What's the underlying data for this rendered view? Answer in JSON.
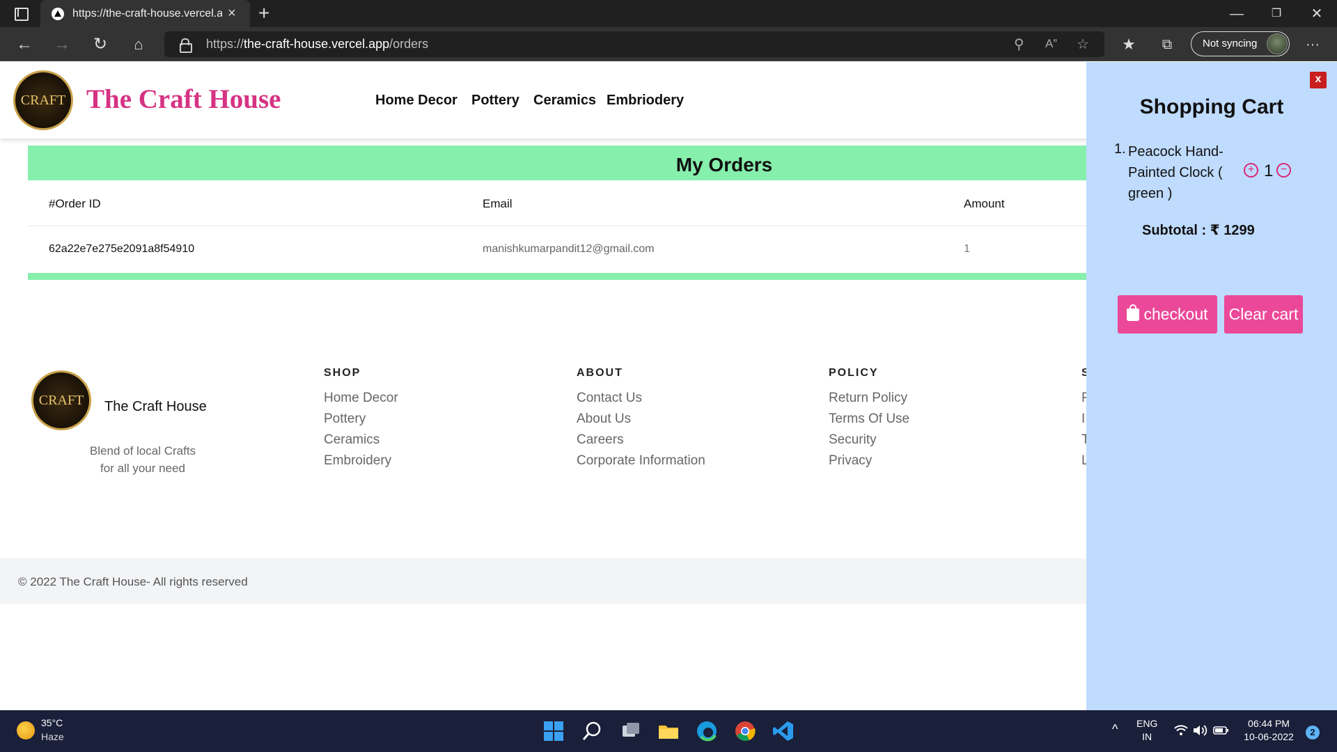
{
  "browser": {
    "tab_title": "https://the-craft-house.vercel.app/orders",
    "tab_close": "×",
    "new_tab": "+",
    "url_prefix": "https://",
    "url_host": "the-craft-house.vercel.app",
    "url_path": "/orders",
    "sync_label": "Not syncing",
    "win_minimize": "—",
    "win_restore": "❐",
    "win_close": "✕",
    "more": "···"
  },
  "site": {
    "brand": "The Craft House",
    "logo_text": "CRAFT",
    "nav": [
      "Home Decor",
      "Pottery",
      "Ceramics",
      "Embriodery"
    ]
  },
  "orders": {
    "title": "My Orders",
    "columns": [
      "#Order ID",
      "Email",
      "Amount"
    ],
    "rows": [
      {
        "id": "62a22e7e275e2091a8f54910",
        "email": "manishkumarpandit12@gmail.com",
        "amount": "1"
      }
    ]
  },
  "footer": {
    "name": "The Craft House",
    "tagline_1": "Blend of local Crafts",
    "tagline_2": "for all your need",
    "columns": [
      {
        "heading": "SHOP",
        "links": [
          "Home Decor",
          "Pottery",
          "Ceramics",
          "Embroidery"
        ]
      },
      {
        "heading": "ABOUT",
        "links": [
          "Contact Us",
          "About Us",
          "Careers",
          "Corporate Information"
        ]
      },
      {
        "heading": "POLICY",
        "links": [
          "Return Policy",
          "Terms Of Use",
          "Security",
          "Privacy"
        ]
      },
      {
        "heading": "S",
        "links": [
          "F",
          "I",
          "T",
          "L"
        ]
      }
    ],
    "copyright": "© 2022 The Craft House- All rights reserved"
  },
  "cart": {
    "close": "x",
    "title": "Shopping Cart",
    "items": [
      {
        "index": "1.",
        "line1": "Peacock Hand-",
        "line2": "Painted Clock (",
        "line3": "green )",
        "qty": "1",
        "plus": "+",
        "minus": "−"
      }
    ],
    "subtotal": "Subtotal : ₹ 1299",
    "checkout": "checkout",
    "clear": "Clear cart"
  },
  "taskbar": {
    "temp": "35°C",
    "condition": "Haze",
    "lang_1": "ENG",
    "lang_2": "IN",
    "time": "06:44 PM",
    "date": "10-06-2022",
    "notifications": "2",
    "chevron": "^"
  },
  "colors": {
    "brand_pink": "#d63384",
    "accent_green": "#86efac",
    "cart_bg": "#bfdbfe",
    "button_pink": "#ec4899",
    "close_red": "#c81e1e"
  },
  "icons": [
    "tab-actions-icon",
    "back-icon",
    "forward-icon",
    "refresh-icon",
    "home-icon",
    "lock-icon",
    "key-icon",
    "read-aloud-icon",
    "add-favorite-icon",
    "favorites-icon",
    "collections-icon",
    "shopping-bag-icon",
    "plus-circle-icon",
    "minus-circle-icon",
    "windows-start-icon",
    "search-icon",
    "task-view-icon",
    "file-explorer-icon",
    "edge-icon",
    "chrome-icon",
    "vscode-icon",
    "wifi-icon",
    "volume-icon",
    "battery-icon"
  ]
}
